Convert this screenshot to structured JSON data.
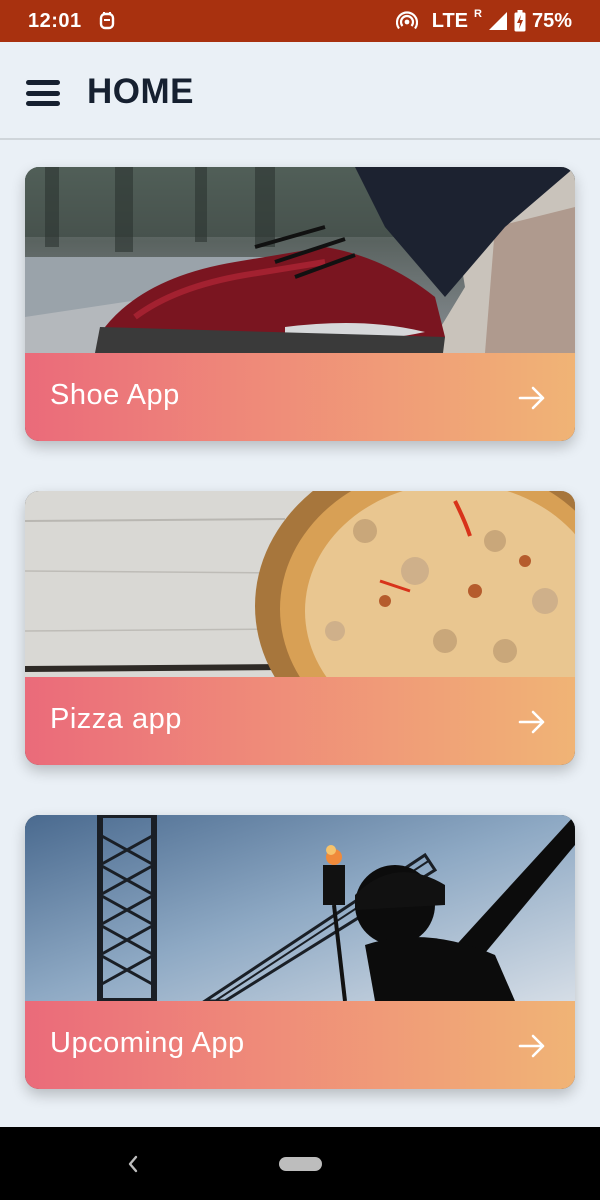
{
  "status_bar": {
    "time": "12:01",
    "network": "LTE",
    "roaming": "R",
    "battery": "75%",
    "icons": [
      "notification-icon",
      "hotspot-icon",
      "signal-icon",
      "battery-icon"
    ]
  },
  "app_bar": {
    "title": "HOME",
    "menu_icon": "hamburger-menu-icon"
  },
  "cards": [
    {
      "label": "Shoe App",
      "image": "sneaker-photo",
      "icon": "arrow-right-icon"
    },
    {
      "label": "Pizza app",
      "image": "pizza-photo",
      "icon": "arrow-right-icon"
    },
    {
      "label": "Upcoming App",
      "image": "construction-worker-photo",
      "icon": "arrow-right-icon"
    }
  ],
  "colors": {
    "status_bar": "#a8310f",
    "background": "#eaf0f6",
    "title": "#162030",
    "gradient_start": "#f26d7d",
    "gradient_end": "#f8b978"
  },
  "nav_bar": {
    "back_icon": "back-chevron-icon",
    "home_icon": "home-pill-icon"
  }
}
